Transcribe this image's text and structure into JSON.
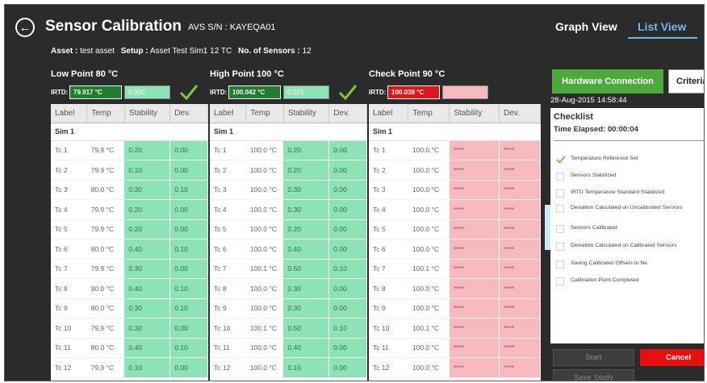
{
  "header": {
    "title": "Sensor Calibration",
    "serial_label": "AVS S/N :",
    "serial_value": "KAYEQA01",
    "asset_label": "Asset :",
    "asset_value": "test asset",
    "setup_label": "Setup :",
    "setup_value": "Asset Test Sim1 12 TC",
    "sensors_label": "No. of Sensors :",
    "sensors_value": "12"
  },
  "view_tabs": {
    "graph": "Graph View",
    "list": "List View",
    "active": "list"
  },
  "points": [
    {
      "heading": "Low Point  80 °C",
      "irtd_label": "IRTD:",
      "irtd_value": "79.917 °C",
      "irtd_color": "#1f7d30",
      "stability_value": "0.000",
      "stability_color": "#8de3b6",
      "status": "ok",
      "columns": [
        "Label",
        "Temp",
        "Stability",
        "Dev."
      ],
      "group": "Sim 1",
      "rows": [
        {
          "label": "Tc 1",
          "temp": "79.9 °C",
          "stability": "0.20",
          "dev": "0.00"
        },
        {
          "label": "Tc 2",
          "temp": "79.9 °C",
          "stability": "0.10",
          "dev": "0.00"
        },
        {
          "label": "Tc 3",
          "temp": "80.0 °C",
          "stability": "0.30",
          "dev": "0.10"
        },
        {
          "label": "Tc 4",
          "temp": "79.9 °C",
          "stability": "0.20",
          "dev": "0.00"
        },
        {
          "label": "Tc 5",
          "temp": "79.9 °C",
          "stability": "0.20",
          "dev": "0.00"
        },
        {
          "label": "Tc 6",
          "temp": "80.0 °C",
          "stability": "0.40",
          "dev": "0.10"
        },
        {
          "label": "Tc 7",
          "temp": "79.9 °C",
          "stability": "0.30",
          "dev": "0.00"
        },
        {
          "label": "Tc 8",
          "temp": "80.0 °C",
          "stability": "0.40",
          "dev": "0.10"
        },
        {
          "label": "Tc 9",
          "temp": "80.0 °C",
          "stability": "0.30",
          "dev": "0.10"
        },
        {
          "label": "Tc 10",
          "temp": "79.9 °C",
          "stability": "0.30",
          "dev": "0.00"
        },
        {
          "label": "Tc 11",
          "temp": "80.0 °C",
          "stability": "0.40",
          "dev": "0.10"
        },
        {
          "label": "Tc 12",
          "temp": "79.9 °C",
          "stability": "0.10",
          "dev": "0.00"
        }
      ]
    },
    {
      "heading": "High Point  100 °C",
      "irtd_label": "IRTD:",
      "irtd_value": "100.042 °C",
      "irtd_color": "#1f7d30",
      "stability_value": "0.025",
      "stability_color": "#8de3b6",
      "status": "ok",
      "columns": [
        "Label",
        "Temp",
        "Stability",
        "Dev."
      ],
      "group": "Sim 1",
      "rows": [
        {
          "label": "Tc 1",
          "temp": "100.0 °C",
          "stability": "0.20",
          "dev": "0.00"
        },
        {
          "label": "Tc 2",
          "temp": "100.0 °C",
          "stability": "0.20",
          "dev": "0.00"
        },
        {
          "label": "Tc 3",
          "temp": "100.0 °C",
          "stability": "0.30",
          "dev": "0.00"
        },
        {
          "label": "Tc 4",
          "temp": "100.0 °C",
          "stability": "0.30",
          "dev": "0.00"
        },
        {
          "label": "Tc 5",
          "temp": "100.0 °C",
          "stability": "0.20",
          "dev": "0.00"
        },
        {
          "label": "Tc 6",
          "temp": "100.0 °C",
          "stability": "0.40",
          "dev": "0.00"
        },
        {
          "label": "Tc 7",
          "temp": "100.1 °C",
          "stability": "0.50",
          "dev": "0.10"
        },
        {
          "label": "Tc 8",
          "temp": "100.0 °C",
          "stability": "0.30",
          "dev": "0.00"
        },
        {
          "label": "Tc 9",
          "temp": "100.0 °C",
          "stability": "0.30",
          "dev": "0.00"
        },
        {
          "label": "Tc 10",
          "temp": "100.1 °C",
          "stability": "0.50",
          "dev": "0.10"
        },
        {
          "label": "Tc 11",
          "temp": "100.0 °C",
          "stability": "0.40",
          "dev": "0.00"
        },
        {
          "label": "Tc 12",
          "temp": "100.0 °C",
          "stability": "0.10",
          "dev": "0.00"
        }
      ]
    },
    {
      "heading": "Check Point  90 °C",
      "irtd_label": "IRTD:",
      "irtd_value": "100.038 °C",
      "irtd_color": "#e3131a",
      "stability_value": "",
      "stability_color": "#f6b9bd",
      "status": "pending",
      "columns": [
        "Label",
        "Temp",
        "Stability",
        "Dev."
      ],
      "group": "Sim 1",
      "rows": [
        {
          "label": "Tc 1",
          "temp": "100.0 °C",
          "stability": "****",
          "dev": "****"
        },
        {
          "label": "Tc 2",
          "temp": "100.0 °C",
          "stability": "****",
          "dev": "****"
        },
        {
          "label": "Tc 3",
          "temp": "100.0 °C",
          "stability": "****",
          "dev": "****"
        },
        {
          "label": "Tc 4",
          "temp": "100.0 °C",
          "stability": "****",
          "dev": "****"
        },
        {
          "label": "Tc 5",
          "temp": "100.0 °C",
          "stability": "****",
          "dev": "****"
        },
        {
          "label": "Tc 6",
          "temp": "100.0 °C",
          "stability": "****",
          "dev": "****"
        },
        {
          "label": "Tc 7",
          "temp": "100.1 °C",
          "stability": "****",
          "dev": "****"
        },
        {
          "label": "Tc 8",
          "temp": "100.0 °C",
          "stability": "****",
          "dev": "****"
        },
        {
          "label": "Tc 9",
          "temp": "100.0 °C",
          "stability": "****",
          "dev": "****"
        },
        {
          "label": "Tc 10",
          "temp": "100.1 °C",
          "stability": "****",
          "dev": "****"
        },
        {
          "label": "Tc 11",
          "temp": "100.0 °C",
          "stability": "****",
          "dev": "****"
        },
        {
          "label": "Tc 12",
          "temp": "100.0 °C",
          "stability": "****",
          "dev": "****"
        }
      ]
    }
  ],
  "side": {
    "hardware_button": "Hardware Connection",
    "criteria_button": "Criteria",
    "timestamp": "28-Aug-2015 14:58:44",
    "checklist_title": "Checklist",
    "time_elapsed": "Time Elapsed: 00:00:04",
    "items": [
      {
        "text": "Temperature Reference Set",
        "done": true
      },
      {
        "text": "Sensors Stabilized",
        "done": false
      },
      {
        "text": "IRTD Temperature Standard Stabilized",
        "done": false
      },
      {
        "text": "Deviation Calculated on Uncalibrated Sensors",
        "done": false
      },
      {
        "text": "Sensors Calibrated",
        "done": false
      },
      {
        "text": "Deviation Calculated on Calibrated Sensors",
        "done": false
      },
      {
        "text": "Saving Calibrated Offsets to file",
        "done": false
      },
      {
        "text": "Calibration Point Completed",
        "done": false
      }
    ],
    "start_button": "Start",
    "cancel_button": "Cancel",
    "save_button": "Save Study"
  },
  "colors": {
    "ok_cell": "#8de3b6",
    "bad_cell": "#f6b9bd",
    "accent_blue": "#6fb8e6",
    "hardware_green": "#4caa3c",
    "cancel_red": "#e8100e",
    "check_green": "#7ac943"
  },
  "icons": {
    "back": "back-arrow-circle-icon",
    "status_ok": "checkmark-icon",
    "drawer": "chevron-right-icon"
  }
}
